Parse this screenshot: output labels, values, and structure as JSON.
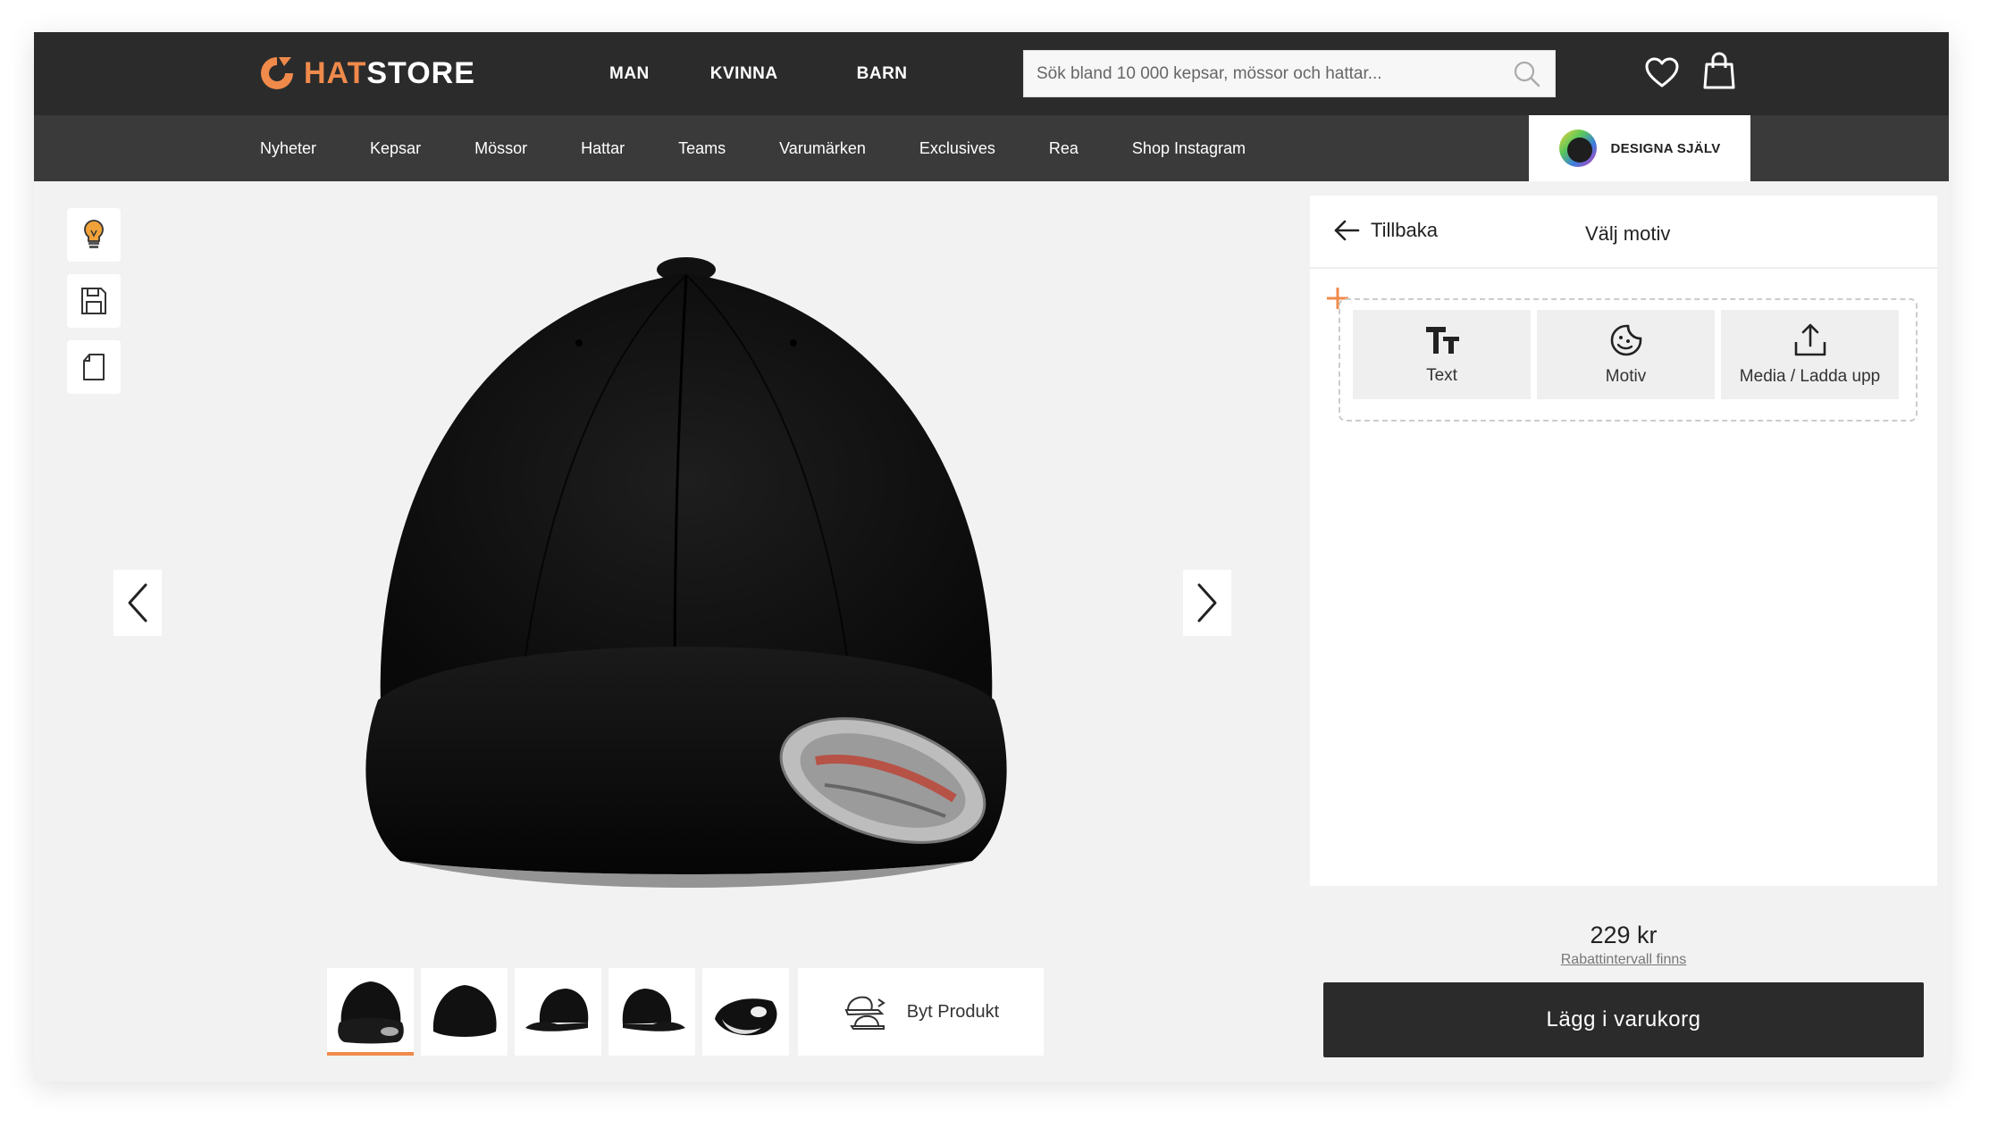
{
  "brand": {
    "prefix": "HAT",
    "suffix": "STORE",
    "accent": "#f08a4b"
  },
  "main_nav": [
    "MAN",
    "KVINNA",
    "BARN"
  ],
  "search": {
    "placeholder": "Sök bland 10 000 kepsar, mössor och hattar..."
  },
  "sub_nav": [
    "Nyheter",
    "Kepsar",
    "Mössor",
    "Hattar",
    "Teams",
    "Varumärken",
    "Exclusives",
    "Rea",
    "Shop Instagram"
  ],
  "design_tab": {
    "label": "DESIGNA SJÄLV"
  },
  "tools": [
    {
      "icon": "lightbulb-icon"
    },
    {
      "icon": "save-icon"
    },
    {
      "icon": "new-page-icon"
    }
  ],
  "product": {
    "name_icon": "black-baseball-cap"
  },
  "thumbnails": [
    "front",
    "side-back",
    "left",
    "right",
    "inside"
  ],
  "swap_product": {
    "label": "Byt Produkt"
  },
  "panel": {
    "back_label": "Tillbaka",
    "title": "Välj motiv",
    "options": [
      {
        "label": "Text",
        "icon": "text-icon"
      },
      {
        "label": "Motiv",
        "icon": "sticker-icon"
      },
      {
        "label": "Media / Ladda upp",
        "icon": "upload-icon"
      }
    ]
  },
  "price": {
    "value": "229 kr",
    "discount_link": "Rabattintervall finns"
  },
  "cart": {
    "label": "Lägg i varukorg"
  },
  "colors": {
    "header": "#2b2b2b",
    "subheader": "#3a3a3a",
    "accent": "#f08a4b"
  }
}
